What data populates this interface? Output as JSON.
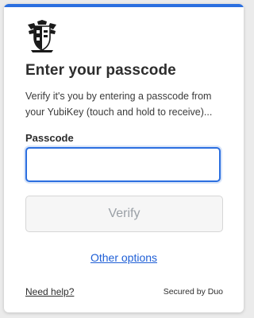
{
  "brand": {
    "accent_color": "#2b6fe0",
    "logo_icon": "university-crest-icon"
  },
  "prompt": {
    "title": "Enter your passcode",
    "description": "Verify it's you by entering a passcode from your YubiKey (touch and hold to receive)..."
  },
  "passcode": {
    "label": "Passcode",
    "value": "",
    "placeholder": ""
  },
  "actions": {
    "verify_label": "Verify",
    "other_options_label": "Other options"
  },
  "footer": {
    "help_label": "Need help?",
    "secured_label": "Secured by Duo"
  }
}
